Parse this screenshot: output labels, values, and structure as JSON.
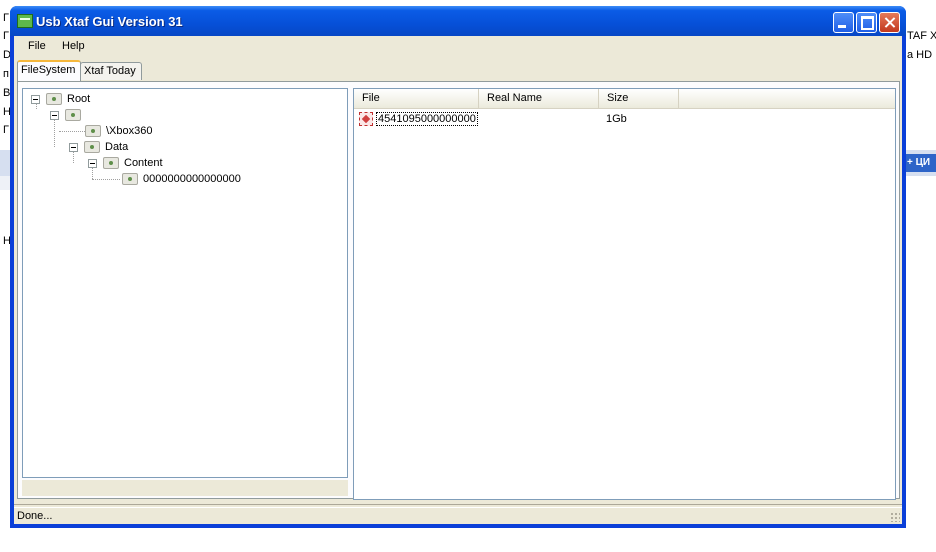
{
  "background": {
    "left_glyphs": [
      "Г",
      "Г",
      "D",
      "п",
      "B",
      "H",
      "Г",
      "H"
    ],
    "right_text": [
      "TAF X",
      "a HD"
    ],
    "right_badge": "+ ЦИ"
  },
  "window": {
    "title": "Usb Xtaf Gui Version 31",
    "controls": {
      "minimize": "minimize",
      "maximize": "maximize",
      "close": "close"
    }
  },
  "menu": {
    "file": "File",
    "help": "Help"
  },
  "tabs": [
    {
      "label": "FileSystem",
      "active": true
    },
    {
      "label": "Xtaf Today",
      "active": false
    }
  ],
  "tree": {
    "root": "Root",
    "unnamed": "",
    "xbox360": "\\Xbox360",
    "data": "Data",
    "content": "Content",
    "id": "0000000000000000"
  },
  "list": {
    "columns": [
      "File",
      "Real Name",
      "Size"
    ],
    "rows": [
      {
        "file": "4541095000000000",
        "real_name": "",
        "size": "1Gb"
      }
    ]
  },
  "status": {
    "text": "Done..."
  }
}
